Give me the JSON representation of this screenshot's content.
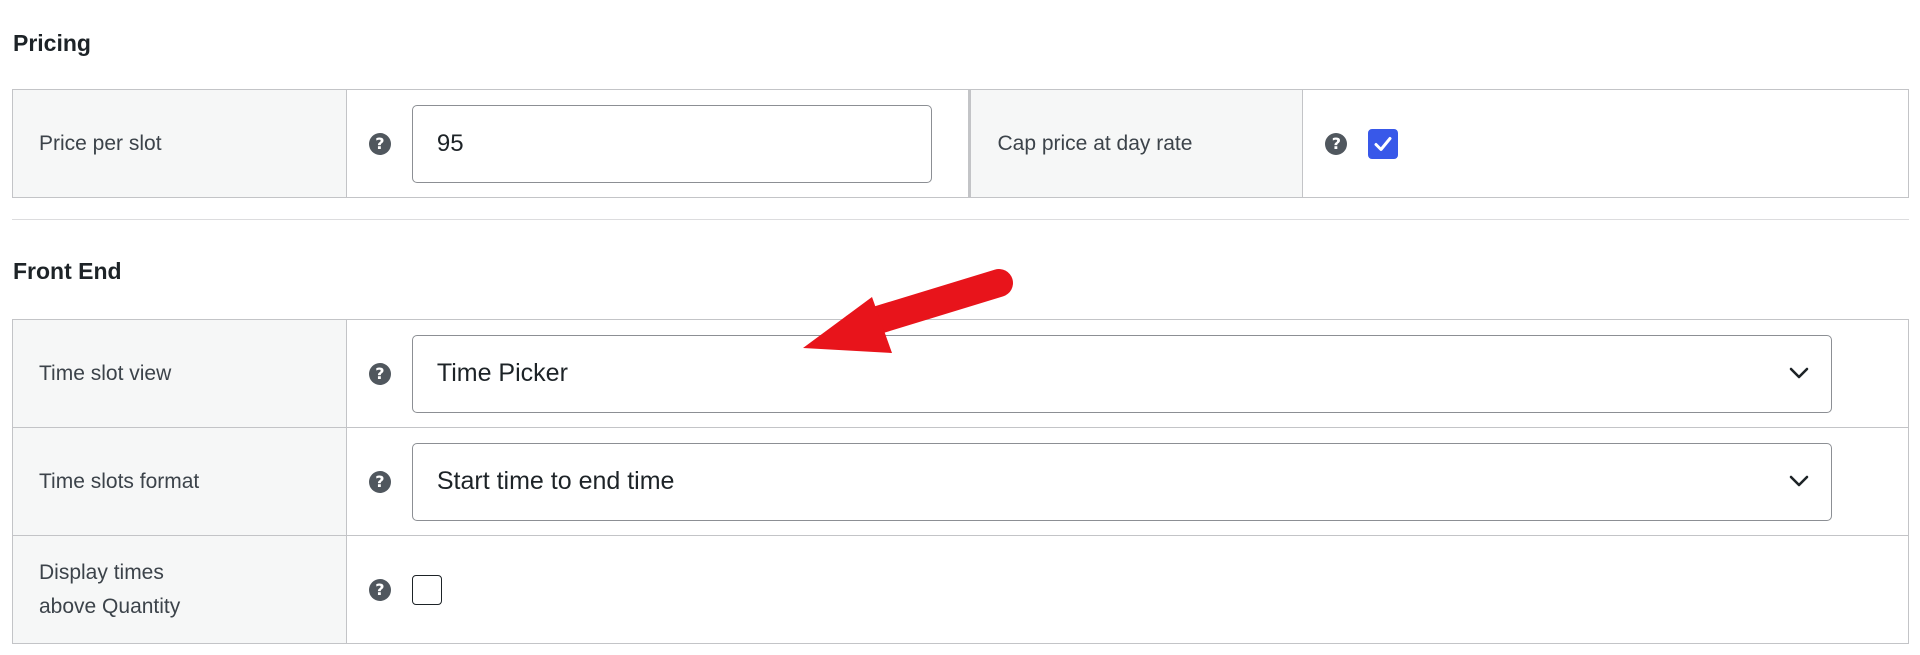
{
  "pricing": {
    "title": "Pricing",
    "price_per_slot": {
      "label": "Price per slot",
      "value": "95",
      "help_icon": "question-circle-icon"
    },
    "cap_price": {
      "label": "Cap price at day rate",
      "checked": true,
      "help_icon": "question-circle-icon"
    }
  },
  "front_end": {
    "title": "Front End",
    "time_slot_view": {
      "label": "Time slot view",
      "selected": "Time Picker",
      "help_icon": "question-circle-icon"
    },
    "time_slots_format": {
      "label": "Time slots format",
      "selected": "Start time to end time",
      "help_icon": "question-circle-icon"
    },
    "display_times": {
      "label_line1": "Display times",
      "label_line2": "above Quantity",
      "checked": false,
      "help_icon": "question-circle-icon"
    }
  },
  "colors": {
    "checkbox_checked": "#3858e9",
    "annotation_arrow": "#e8141b"
  },
  "help_glyph": "?"
}
